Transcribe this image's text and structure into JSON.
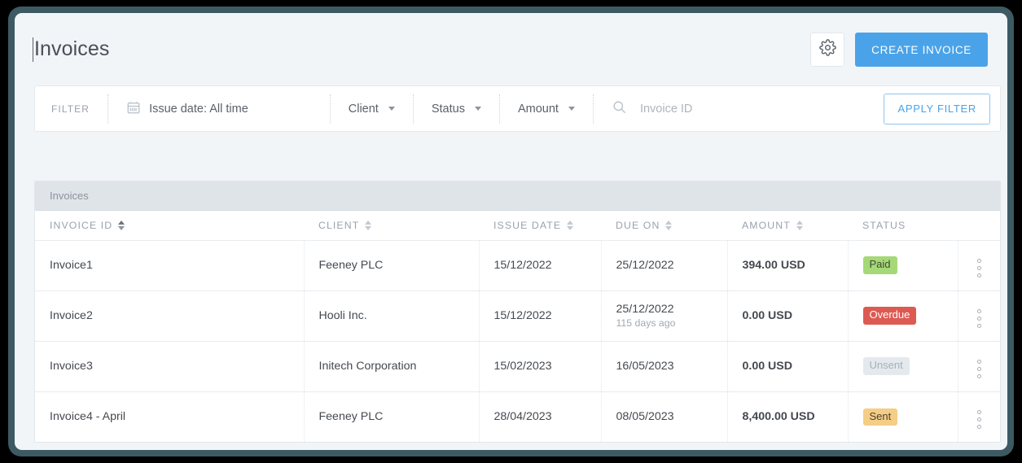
{
  "header": {
    "title": "Invoices",
    "settings_icon": "gear-icon",
    "create_invoice_label": "CREATE INVOICE"
  },
  "filter": {
    "label": "FILTER",
    "calendar_icon": "calendar-icon",
    "issue_date": "Issue date: All time",
    "client": "Client",
    "status": "Status",
    "amount": "Amount",
    "search_icon": "search-icon",
    "search_value": "",
    "search_placeholder": "Invoice ID",
    "apply_label": "APPLY FILTER"
  },
  "table": {
    "tab_label": "Invoices",
    "columns": [
      {
        "label": "INVOICE ID",
        "sortable": true,
        "active": true
      },
      {
        "label": "CLIENT",
        "sortable": true,
        "active": false
      },
      {
        "label": "ISSUE DATE",
        "sortable": true,
        "active": false
      },
      {
        "label": "DUE ON",
        "sortable": true,
        "active": false
      },
      {
        "label": "AMOUNT",
        "sortable": true,
        "active": false
      },
      {
        "label": "STATUS",
        "sortable": false,
        "active": false
      },
      {
        "label": "",
        "sortable": false,
        "active": false
      }
    ],
    "rows": [
      {
        "invoice_id": "Invoice1",
        "client": "Feeney PLC",
        "issue_date": "15/12/2022",
        "due_on": "25/12/2022",
        "due_sub": "",
        "amount": "394.00 USD",
        "status": "Paid",
        "status_kind": "paid"
      },
      {
        "invoice_id": "Invoice2",
        "client": "Hooli Inc.",
        "issue_date": "15/12/2022",
        "due_on": "25/12/2022",
        "due_sub": "115 days ago",
        "amount": "0.00 USD",
        "status": "Overdue",
        "status_kind": "overdue"
      },
      {
        "invoice_id": "Invoice3",
        "client": "Initech Corporation",
        "issue_date": "15/02/2023",
        "due_on": "16/05/2023",
        "due_sub": "",
        "amount": "0.00 USD",
        "status": "Unsent",
        "status_kind": "unsent"
      },
      {
        "invoice_id": "Invoice4 - April",
        "client": "Feeney PLC",
        "issue_date": "28/04/2023",
        "due_on": "08/05/2023",
        "due_sub": "",
        "amount": "8,400.00 USD",
        "status": "Sent",
        "status_kind": "sent"
      }
    ]
  },
  "colors": {
    "accent": "#4aa3e8",
    "frame": "#3d5a63",
    "page_bg": "#f1f5f8",
    "paid": "#a5d977",
    "overdue": "#dd5a52",
    "unsent": "#e4e9ee",
    "sent": "#f4cd87"
  }
}
